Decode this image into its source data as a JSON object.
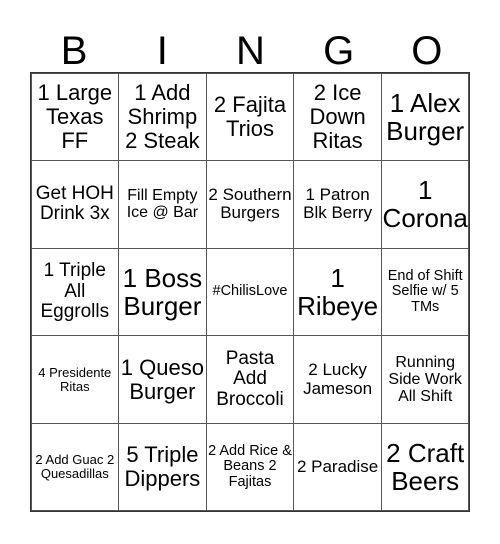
{
  "header": {
    "letters": [
      "B",
      "I",
      "N",
      "G",
      "O"
    ]
  },
  "board": {
    "rows": [
      [
        "1 Large Texas FF",
        "1 Add Shrimp 2 Steak",
        "2 Fajita Trios",
        "2 Ice Down Ritas",
        "1 Alex Burger"
      ],
      [
        "Get HOH Drink 3x",
        "Fill Empty Ice @ Bar",
        "2 Southern Burgers",
        "1 Patron Blk Berry",
        "1 Corona"
      ],
      [
        "1 Triple All Eggrolls",
        "1 Boss Burger",
        "#ChilisLove",
        "1 Ribeye",
        "End of Shift Selfie w/ 5 TMs"
      ],
      [
        "4 Presidente Ritas",
        "1 Queso Burger",
        "Pasta Add Broccoli",
        "2 Lucky Jameson",
        "Running Side Work All Shift"
      ],
      [
        "2 Add Guac 2 Quesadillas",
        "5 Triple Dippers",
        "2 Add Rice & Beans 2 Fajitas",
        "2 Paradise",
        "2 Craft Beers"
      ]
    ]
  }
}
